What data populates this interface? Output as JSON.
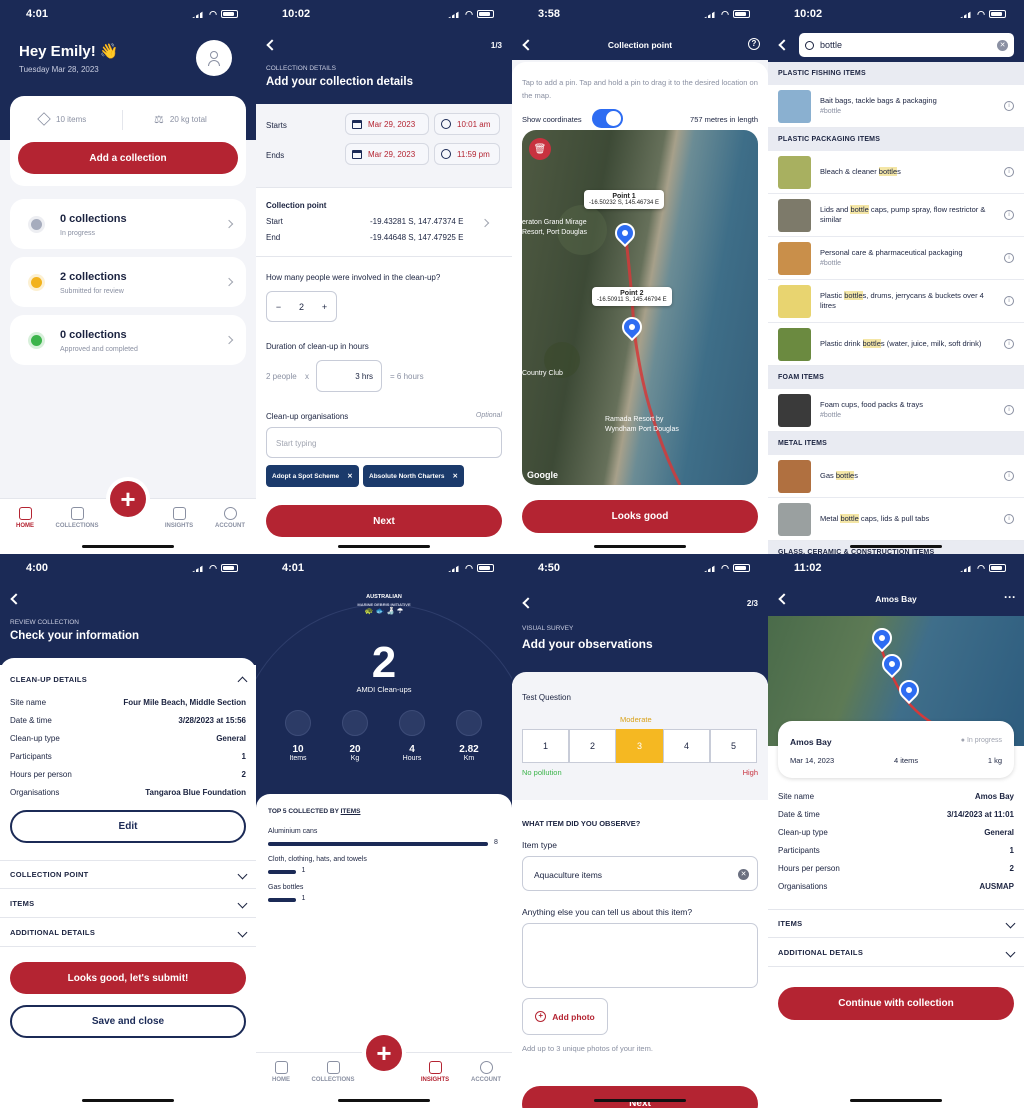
{
  "status": {
    "p1": "4:01",
    "p2": "10:02",
    "p3": "3:58",
    "p4": "10:02",
    "p5": "4:00",
    "p6": "4:01",
    "p7": "4:50",
    "p8": "11:02"
  },
  "home": {
    "greeting": "Hey Emily! 👋",
    "date": "Tuesday Mar 28, 2023",
    "items": "10 items",
    "weight": "20 kg total",
    "add": "Add a collection",
    "collections": [
      {
        "title": "0 collections",
        "sub": "In progress",
        "color": "#a6acbd"
      },
      {
        "title": "2 collections",
        "sub": "Submitted for review",
        "color": "#f2b21d"
      },
      {
        "title": "0 collections",
        "sub": "Approved and completed",
        "color": "#3cb44b"
      }
    ],
    "tabs": [
      "HOME",
      "COLLECTIONS",
      "INSIGHTS",
      "ACCOUNT"
    ]
  },
  "details": {
    "step": "1/3",
    "kicker": "COLLECTION DETAILS",
    "title": "Add your collection details",
    "starts": "Starts",
    "ends": "Ends",
    "start_date": "Mar 29, 2023",
    "start_time": "10:01 am",
    "end_date": "Mar 29, 2023",
    "end_time": "11:59 pm",
    "cp_title": "Collection point",
    "start_label": "Start",
    "start_val": "-19.43281 S, 147.47374 E",
    "end_label": "End",
    "end_val": "-19.44648 S, 147.47925 E",
    "people_q": "How many people were involved in the clean-up?",
    "people": "2",
    "duration_q": "Duration of clean-up in hours",
    "people_word": "2 people",
    "x": "x",
    "hrs": "3 hrs",
    "eq": "= 6 hours",
    "org_label": "Clean-up organisations",
    "optional": "Optional",
    "org_placeholder": "Start typing",
    "chips": [
      "Adopt a Spot Scheme",
      "Absolute North Charters"
    ],
    "next": "Next"
  },
  "map": {
    "title": "Collection point",
    "hint": "Tap to add a pin. Tap and hold a pin to drag it to the desired location on the map.",
    "show_coords": "Show coordinates",
    "length": "757 metres in length",
    "p1": "Point 1",
    "p1c": "-16.50232 S, 145.46734 E",
    "p2": "Point 2",
    "p2c": "-16.50911 S, 145.46794 E",
    "label1": "eraton Grand Mirage Resort, Port Douglas",
    "label2": "Country Club",
    "label3": "Ramada Resort by Wyndham Port Douglas",
    "google": "Google",
    "ok": "Looks good"
  },
  "search": {
    "query": "bottle",
    "sections": [
      {
        "title": "PLASTIC FISHING ITEMS",
        "items": [
          {
            "pre": "Bait bags, tackle bags & packaging",
            "tag": "#bottle"
          }
        ]
      },
      {
        "title": "PLASTIC PACKAGING ITEMS",
        "items": [
          {
            "pre": "Bleach & cleaner ",
            "hl": "bottle",
            "post": "s"
          },
          {
            "pre": "Lids and ",
            "hl": "bottle",
            "post": " caps, pump spray, flow restrictor & similar"
          },
          {
            "pre": "Personal care & pharmaceutical packaging",
            "tag": "#bottle"
          },
          {
            "pre": "Plastic ",
            "hl": "bottle",
            "post": "s, drums, jerrycans & buckets over 4 litres"
          },
          {
            "pre": "Plastic drink ",
            "hl": "bottle",
            "post": "s (water, juice, milk, soft drink)"
          }
        ]
      },
      {
        "title": "FOAM ITEMS",
        "items": [
          {
            "pre": "Foam cups, food packs & trays",
            "tag": "#bottle"
          }
        ]
      },
      {
        "title": "METAL ITEMS",
        "items": [
          {
            "pre": "Gas ",
            "hl": "bottle",
            "post": "s"
          },
          {
            "pre": "Metal ",
            "hl": "bottle",
            "post": " caps, lids & pull tabs"
          }
        ]
      }
    ],
    "last": "GLASS, CERAMIC & CONSTRUCTION ITEMS"
  },
  "review": {
    "kicker": "REVIEW COLLECTION",
    "title": "Check your information",
    "section": "CLEAN-UP DETAILS",
    "rows": [
      [
        "Site name",
        "Four Mile Beach, Middle Section"
      ],
      [
        "Date & time",
        "3/28/2023 at 15:56"
      ],
      [
        "Clean-up type",
        "General"
      ],
      [
        "Participants",
        "1"
      ],
      [
        "Hours per person",
        "2"
      ],
      [
        "Organisations",
        "Tangaroa Blue Foundation"
      ]
    ],
    "edit": "Edit",
    "acc": [
      "COLLECTION POINT",
      "ITEMS",
      "ADDITIONAL DETAILS"
    ],
    "submit": "Looks good, let's submit!",
    "save": "Save and close"
  },
  "insights": {
    "brand": "AUSTRALIAN",
    "brand2": "MARINE DEBRIS INITIATIVE",
    "count": "2",
    "sub": "AMDI Clean-ups",
    "stats": [
      [
        "10",
        "Items"
      ],
      [
        "20",
        "Kg"
      ],
      [
        "4",
        "Hours"
      ],
      [
        "2.82",
        "Km"
      ]
    ],
    "top": "TOP 5 COLLECTED BY",
    "top_link": "ITEMS",
    "bars": [
      {
        "label": "Aluminium cans",
        "value": 8
      },
      {
        "label": "Cloth, clothing, hats, and towels",
        "value": 1
      },
      {
        "label": "Gas bottles",
        "value": 1
      }
    ]
  },
  "observe": {
    "step": "2/3",
    "kicker": "VISUAL SURVEY",
    "title": "Add your observations",
    "q": "Test Question",
    "level": "Moderate",
    "scale": [
      "1",
      "2",
      "3",
      "4",
      "5"
    ],
    "low": "No pollution",
    "high": "High",
    "what": "WHAT ITEM DID YOU OBSERVE?",
    "type_label": "Item type",
    "type_val": "Aquaculture items",
    "more": "Anything else you can tell us about this item?",
    "photo": "Add photo",
    "photo_hint": "Add up to 3 unique photos of your item.",
    "next": "Next"
  },
  "amos": {
    "title": "Amos Bay",
    "card_title": "Amos Bay",
    "status": "In progress",
    "date": "Mar 14, 2023",
    "items": "4 items",
    "kg": "1 kg",
    "rows": [
      [
        "Site name",
        "Amos Bay"
      ],
      [
        "Date & time",
        "3/14/2023 at 11:01"
      ],
      [
        "Clean-up type",
        "General"
      ],
      [
        "Participants",
        "1"
      ],
      [
        "Hours per person",
        "2"
      ],
      [
        "Organisations",
        "AUSMAP"
      ]
    ],
    "acc": [
      "ITEMS",
      "ADDITIONAL DETAILS"
    ],
    "cont": "Continue with collection"
  }
}
